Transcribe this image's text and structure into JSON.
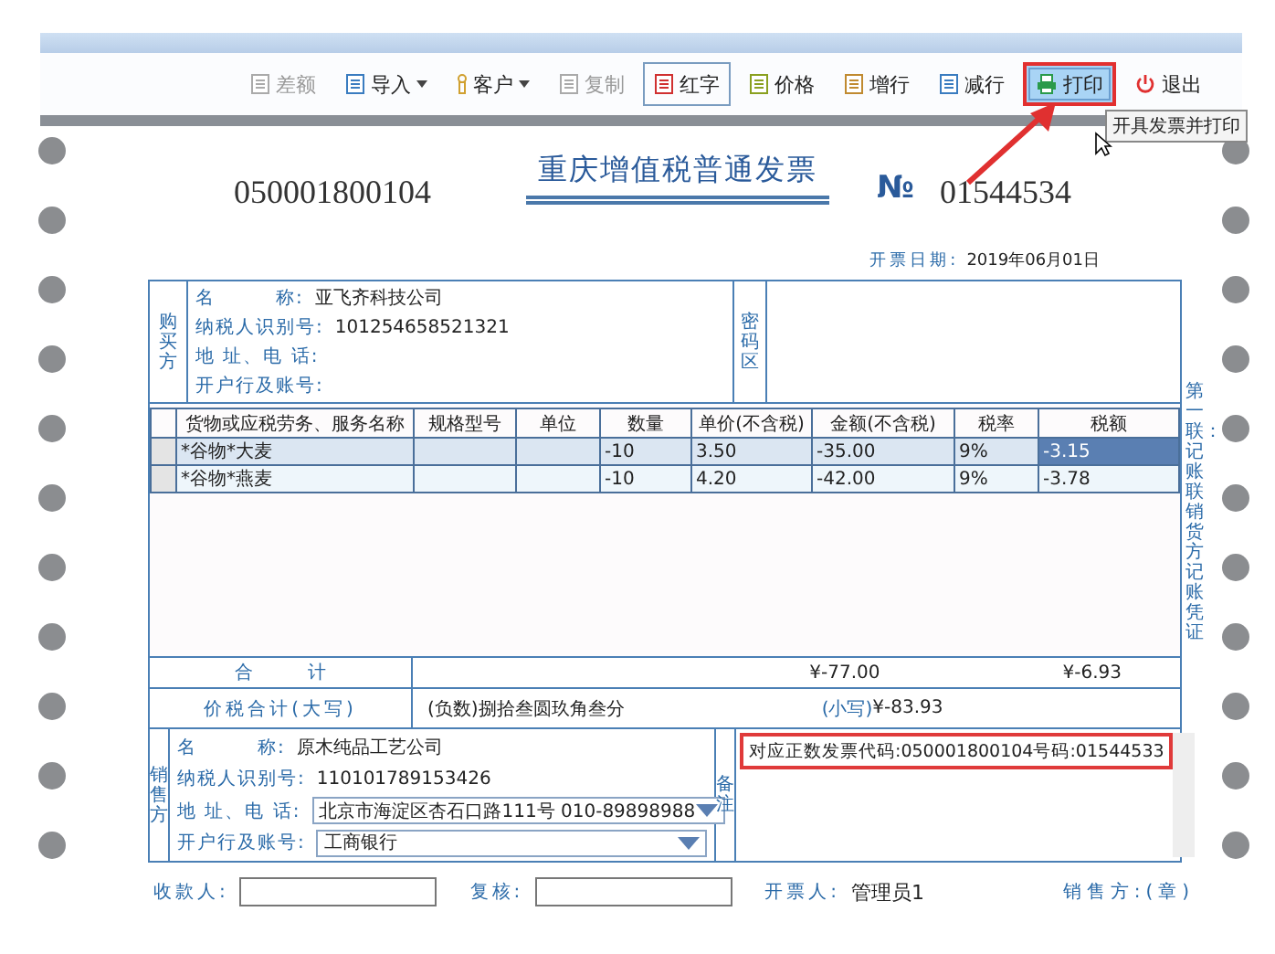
{
  "toolbar": [
    {
      "label": "差额",
      "kind": "doc",
      "disabled": true,
      "dropdown": false,
      "pressed": false,
      "highlighted": false
    },
    {
      "label": "导入",
      "kind": "import",
      "disabled": false,
      "dropdown": true,
      "pressed": false,
      "highlighted": false
    },
    {
      "label": "客户",
      "kind": "person",
      "disabled": false,
      "dropdown": true,
      "pressed": false,
      "highlighted": false
    },
    {
      "label": "复制",
      "kind": "copy",
      "disabled": true,
      "dropdown": false,
      "pressed": false,
      "highlighted": false
    },
    {
      "label": "红字",
      "kind": "red",
      "disabled": false,
      "dropdown": false,
      "pressed": true,
      "highlighted": false
    },
    {
      "label": "价格",
      "kind": "price",
      "disabled": false,
      "dropdown": false,
      "pressed": false,
      "highlighted": false
    },
    {
      "label": "增行",
      "kind": "addrow",
      "disabled": false,
      "dropdown": false,
      "pressed": false,
      "highlighted": false
    },
    {
      "label": "减行",
      "kind": "delrow",
      "disabled": false,
      "dropdown": false,
      "pressed": false,
      "highlighted": false
    },
    {
      "label": "打印",
      "kind": "print",
      "disabled": false,
      "dropdown": false,
      "pressed": false,
      "highlighted": true
    },
    {
      "label": "退出",
      "kind": "power",
      "disabled": false,
      "dropdown": false,
      "pressed": false,
      "highlighted": false
    }
  ],
  "tooltip": "开具发票并打印",
  "invoice": {
    "code": "050001800104",
    "title": "重庆增值税普通发票",
    "number_mark": "№",
    "number": "01544534",
    "date_label": "开票日期:",
    "date": "2019年06月01日",
    "buyer": {
      "side_label": "购买方",
      "fields": [
        {
          "label": "名　　　称:",
          "value": "亚飞齐科技公司"
        },
        {
          "label": "纳税人识别号:",
          "value": "101254658521321"
        },
        {
          "label": "地 址、电 话:"
        },
        {
          "label": "开户行及账号:"
        }
      ],
      "password_label": "密码区"
    },
    "columns": [
      "货物或应税劳务、服务名称",
      "规格型号",
      "单位",
      "数量",
      "单价(不含税)",
      "金额(不含税)",
      "税率",
      "税额"
    ],
    "rows": [
      {
        "selected": true,
        "cells": [
          "*谷物*大麦",
          "",
          "",
          "-10",
          "3.50",
          "-35.00",
          "9%",
          "-3.15"
        ]
      },
      {
        "selected": false,
        "cells": [
          "*谷物*燕麦",
          "",
          "",
          "-10",
          "4.20",
          "-42.00",
          "9%",
          "-3.78"
        ]
      }
    ],
    "total_label": "合　　　计",
    "total_amount": "¥-77.00",
    "total_tax": "¥-6.93",
    "grand_label": "价税合计(大写)",
    "grand_words": "(负数)捌拾叁圆玖角叁分",
    "grand_small_label": "(小写)",
    "grand_small": "¥-83.93",
    "seller": {
      "side_label": "销售方",
      "fields": [
        {
          "label": "名　　　称:",
          "value": "原木纯品工艺公司",
          "kind": "text"
        },
        {
          "label": "纳税人识别号:",
          "value": "110101789153426",
          "kind": "text"
        },
        {
          "label": "地 址、电 话:",
          "value": "北京市海淀区杏石口路111号 010-89898988",
          "kind": "select"
        },
        {
          "label": "开户行及账号:",
          "value": "工商银行",
          "kind": "select"
        }
      ],
      "remark_label": "备注",
      "remark": "对应正数发票代码:050001800104号码:01544533",
      "remark_highlighted": true
    },
    "copy_note": "第一联：记账联销货方记账凭证",
    "payee_label": "收款人:",
    "reviewer_label": "复核:",
    "drawer_label": "开票人:",
    "drawer": "管理员1",
    "seller_seal": "销售方:(章)"
  }
}
